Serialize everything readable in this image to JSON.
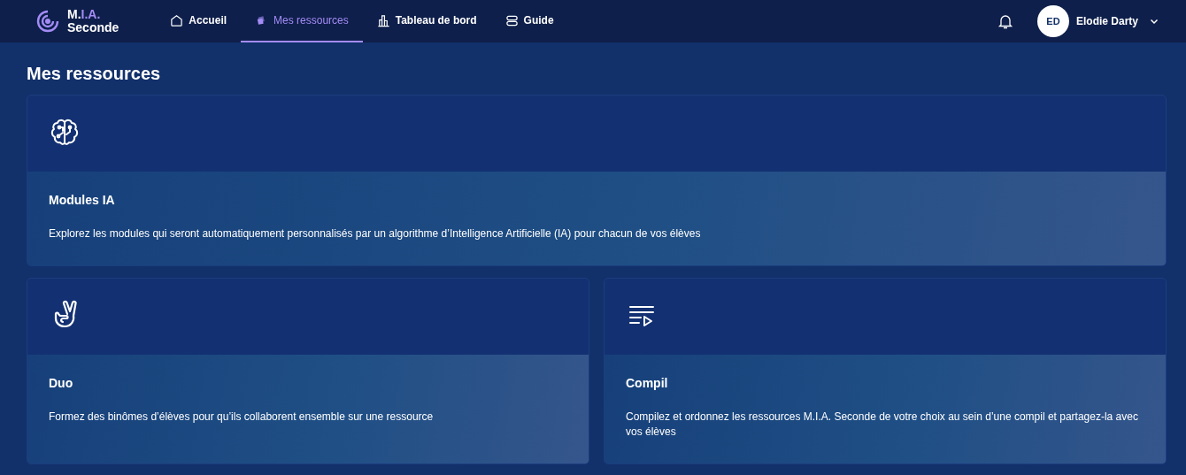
{
  "logo": {
    "title_start": "M.",
    "title_accent": "I.A.",
    "subtitle": "Seconde"
  },
  "nav": [
    {
      "label": "Accueil",
      "kind": "home",
      "selected": false
    },
    {
      "label": "Mes ressources",
      "kind": "resources",
      "selected": true
    },
    {
      "label": "Tableau de bord",
      "kind": "dashboard",
      "selected": false
    },
    {
      "label": "Guide",
      "kind": "guide",
      "selected": false
    }
  ],
  "user": {
    "initials": "ED",
    "name": "Elodie Darty"
  },
  "page_title": "Mes ressources",
  "cards": [
    {
      "kind": "brain",
      "title": "Modules IA",
      "description": "Explorez les modules qui seront automatiquement personnalisés par un algorithme d’Intelligence Artificielle (IA) pour chacun de vos élèves"
    },
    {
      "kind": "hand",
      "title": "Duo",
      "description": "Formez des binômes d’élèves pour qu’ils collaborent ensemble sur une ressource"
    },
    {
      "kind": "playlist",
      "title": "Compil",
      "description": "Compilez et ordonnez les ressources M.I.A. Seconde de votre choix au sein d’une compil et partagez-la avec vos élèves"
    }
  ]
}
